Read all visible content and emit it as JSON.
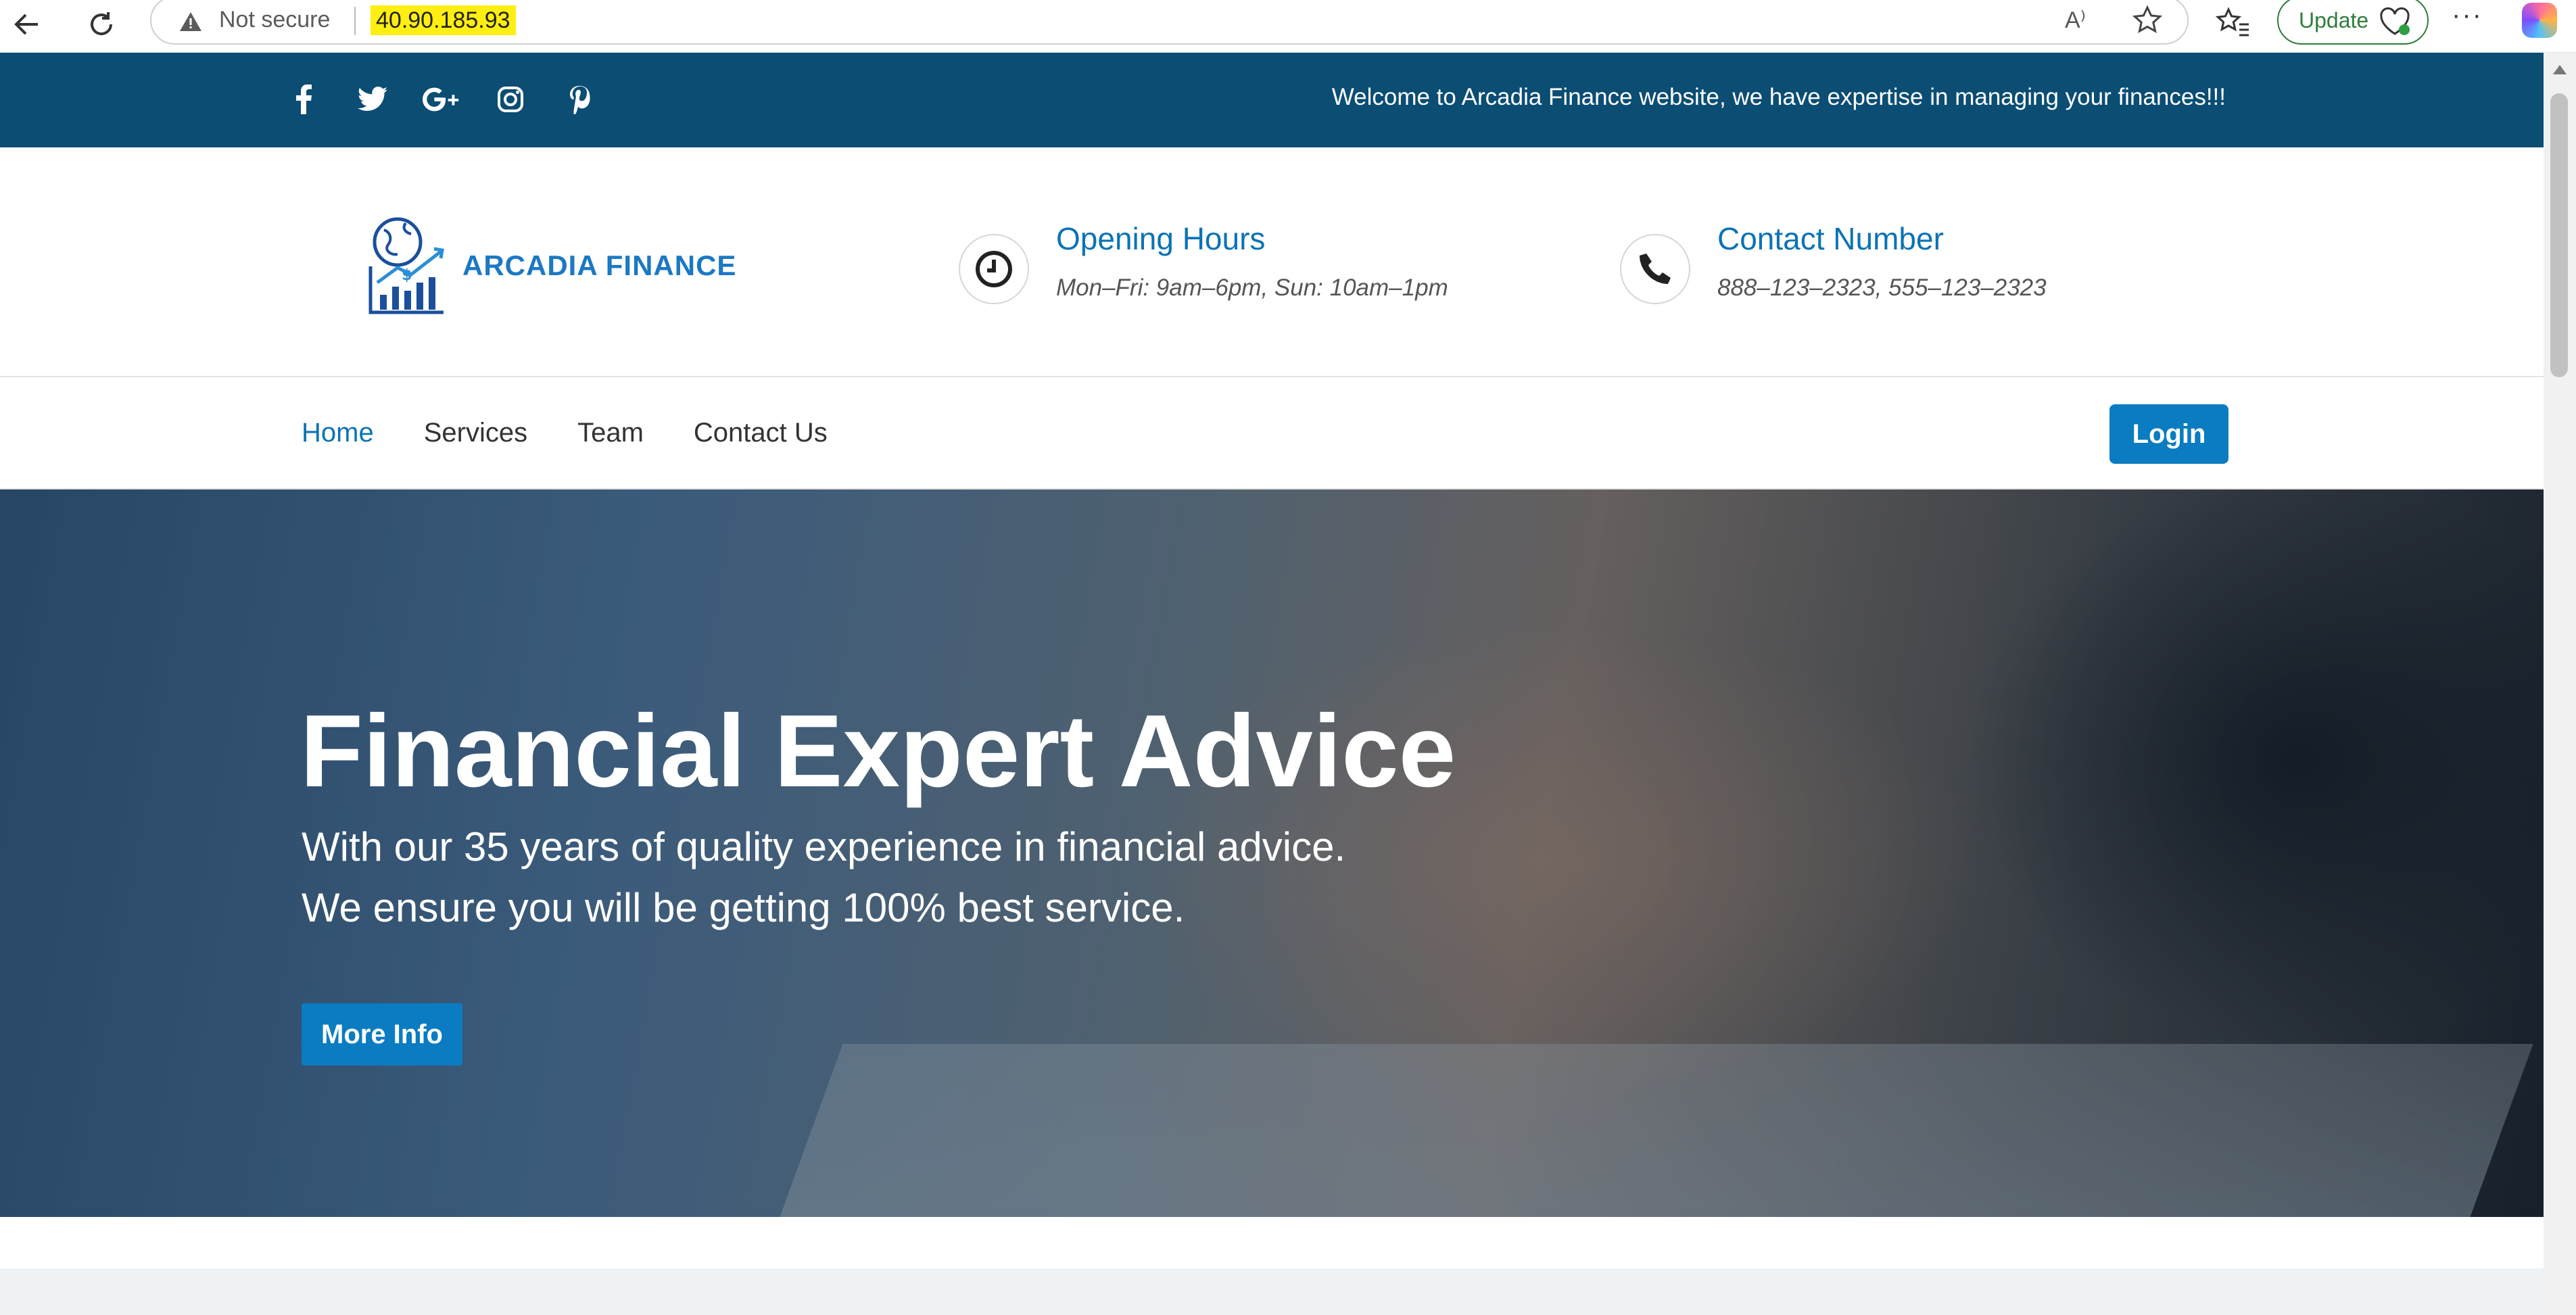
{
  "browser": {
    "security_label": "Not secure",
    "url": "40.90.185.93",
    "update_label": "Update",
    "more_label": "···",
    "read_aloud_label": "A⁾"
  },
  "topbar": {
    "social": [
      "facebook-icon",
      "twitter-icon",
      "google-plus-icon",
      "instagram-icon",
      "pinterest-icon"
    ],
    "welcome_text": "Welcome to Arcadia Finance website, we have expertise in managing your finances!!!"
  },
  "header": {
    "logo_text": "ARCADIA FINANCE",
    "opening_hours": {
      "title": "Opening Hours",
      "text": "Mon–Fri: 9am–6pm, Sun: 10am–1pm"
    },
    "contact": {
      "title": "Contact Number",
      "text": "888–123–2323, 555–123–2323"
    }
  },
  "nav": {
    "items": [
      {
        "label": "Home",
        "active": true
      },
      {
        "label": "Services",
        "active": false
      },
      {
        "label": "Team",
        "active": false
      },
      {
        "label": "Contact Us",
        "active": false
      }
    ],
    "login_label": "Login"
  },
  "hero": {
    "title": "Financial Expert Advice",
    "line1": "With our 35 years of quality experience in financial advice.",
    "line2": "We ensure you will be getting 100% best service.",
    "button_label": "More Info"
  },
  "colors": {
    "topbar": "#0b4d73",
    "accent": "#0b7cc1",
    "link_active": "#0b73b5",
    "url_highlight": "#ffee11"
  }
}
